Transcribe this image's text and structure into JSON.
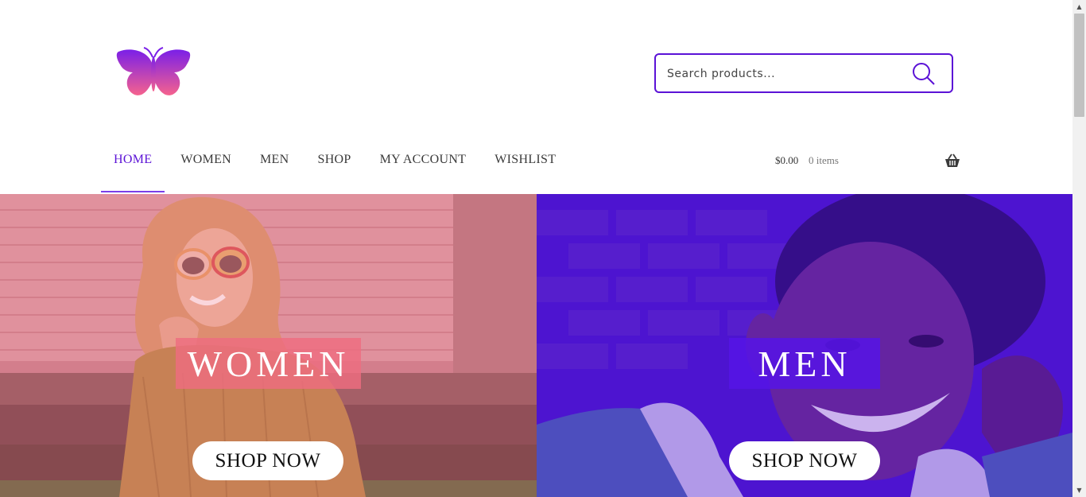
{
  "search": {
    "placeholder": "Search products..."
  },
  "nav": {
    "items": [
      {
        "label": "HOME",
        "active": true
      },
      {
        "label": "WOMEN",
        "active": false
      },
      {
        "label": "MEN",
        "active": false
      },
      {
        "label": "SHOP",
        "active": false
      },
      {
        "label": "MY ACCOUNT",
        "active": false
      },
      {
        "label": "WISHLIST",
        "active": false
      }
    ]
  },
  "cart": {
    "amount": "$0.00",
    "count": "0 items"
  },
  "hero": {
    "women": {
      "title": "WOMEN",
      "button": "SHOP NOW"
    },
    "men": {
      "title": "MEN",
      "button": "SHOP NOW"
    }
  },
  "colors": {
    "accent": "#5b12d6",
    "women_overlay": "#ee6c80",
    "men_overlay": "#5614e6"
  },
  "icons": {
    "logo": "butterfly-logo",
    "search": "search-icon",
    "cart": "basket-icon"
  }
}
